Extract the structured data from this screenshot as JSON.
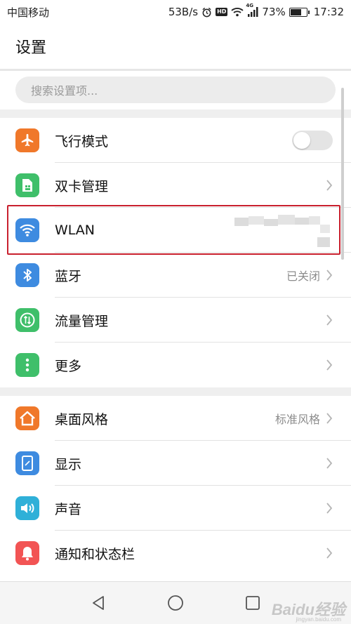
{
  "status_bar": {
    "carrier": "中国移动",
    "net_speed": "53B/s",
    "hd_badge": "HD",
    "network_type": "4G",
    "battery_percent": "73%",
    "battery_level": 0.73,
    "time": "17:32"
  },
  "header": {
    "title": "设置"
  },
  "search": {
    "placeholder": "搜索设置项..."
  },
  "groups": [
    {
      "items": [
        {
          "label": "飞行模式",
          "icon": "airplane-icon",
          "color": "#f0782a",
          "control": "toggle",
          "toggle_on": false
        },
        {
          "label": "双卡管理",
          "icon": "sim-card-icon",
          "color": "#3fbf6a",
          "control": "chevron"
        },
        {
          "label": "WLAN",
          "icon": "wifi-icon",
          "color": "#3e8be0",
          "control": "blurred"
        },
        {
          "label": "蓝牙",
          "icon": "bluetooth-icon",
          "color": "#3e8be0",
          "value": "已关闭",
          "control": "chevron"
        },
        {
          "label": "流量管理",
          "icon": "data-usage-icon",
          "color": "#3fbf6a",
          "control": "chevron"
        },
        {
          "label": "更多",
          "icon": "more-icon",
          "color": "#3fbf6a",
          "control": "chevron"
        }
      ]
    },
    {
      "items": [
        {
          "label": "桌面风格",
          "icon": "home-style-icon",
          "color": "#f0782a",
          "value": "标准风格",
          "control": "chevron"
        },
        {
          "label": "显示",
          "icon": "display-icon",
          "color": "#3e8be0",
          "control": "chevron"
        },
        {
          "label": "声音",
          "icon": "sound-icon",
          "color": "#2fb0d8",
          "control": "chevron"
        },
        {
          "label": "通知和状态栏",
          "icon": "notification-bell-icon",
          "color": "#f25454",
          "control": "chevron"
        }
      ]
    }
  ],
  "nav": {
    "back": "back-icon",
    "home": "home-icon",
    "recents": "recents-icon"
  },
  "watermark": {
    "text": "Baidu经验",
    "sub": "jingyan.baidu.com"
  },
  "colors": {
    "highlight": "#c9202e",
    "group_gap": "#efefef"
  }
}
